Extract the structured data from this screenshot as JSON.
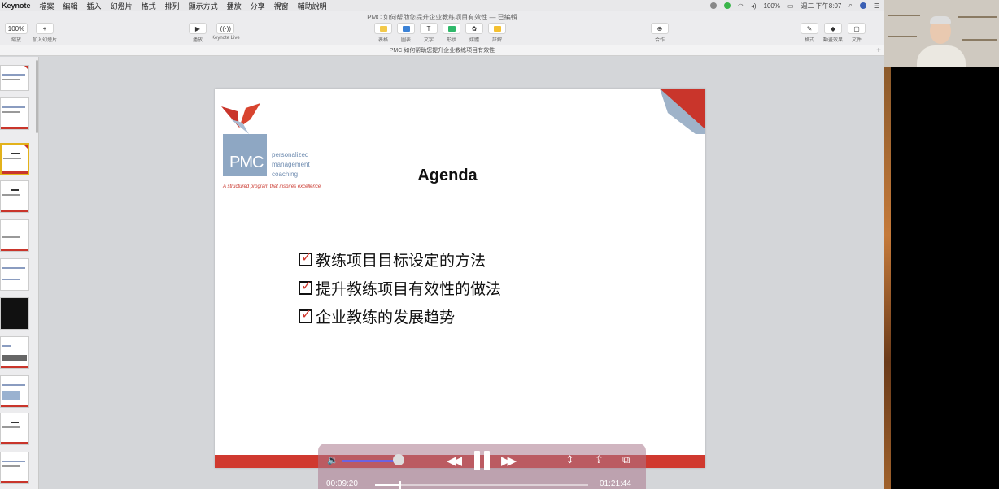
{
  "menubar": {
    "app": "Keynote",
    "items": [
      "檔案",
      "編輯",
      "插入",
      "幻燈片",
      "格式",
      "排列",
      "顯示方式",
      "播放",
      "分享",
      "視窗",
      "輔助說明"
    ],
    "clock": "週二 下午8:07",
    "battery": "100%"
  },
  "window": {
    "title": "PMC 如何帮助您提升企业教练项目有效性 — 已編輯"
  },
  "toolbar": {
    "zoom": "100%",
    "zoom_label": "縮放",
    "add_slide": "加入幻燈片",
    "play": "播放",
    "keynote_live": "Keynote Live",
    "table": "表格",
    "chart": "圖表",
    "text": "文字",
    "shape": "形狀",
    "media": "媒體",
    "comment": "註解",
    "collaborate": "合作",
    "format": "格式",
    "animate": "動畫效果",
    "document": "文件",
    "colors": {
      "table": "#f3c94a",
      "chart": "#3b82d6",
      "shape": "#2fb86a",
      "comment": "#f4c030"
    }
  },
  "document_tab": "PMC 如何帮助您提升企业教练项目有效性",
  "slide": {
    "logo_text": "PMC",
    "logo_tagline": [
      "personalized",
      "management",
      "coaching"
    ],
    "logo_subtitle": "A structured program that inspires excellence",
    "heading": "Agenda",
    "items": [
      "教练项目目标设定的方法",
      "提升教练项目有效性的做法",
      "企业教练的发展趋势"
    ],
    "accent_color": "#d0392f"
  },
  "video": {
    "current_time": "00:09:20",
    "total_time": "01:21:44",
    "progress_fraction": 0.114,
    "volume_fraction": 0.88
  }
}
